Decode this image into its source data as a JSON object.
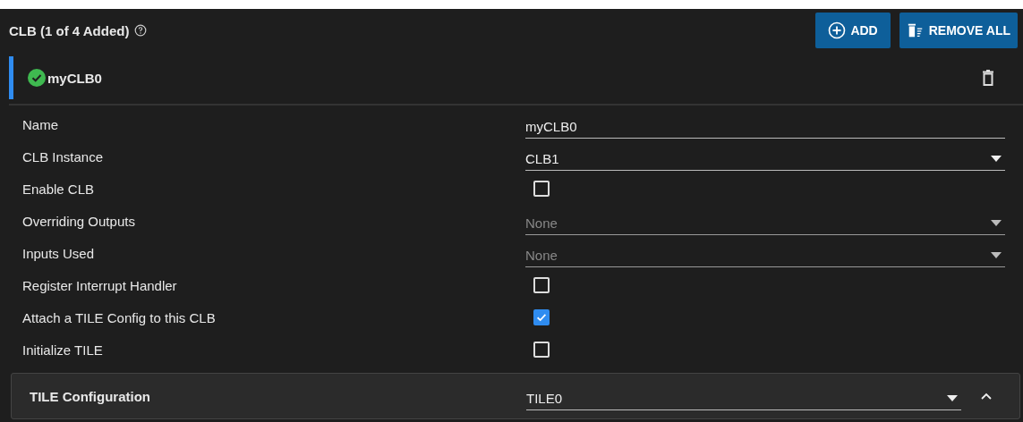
{
  "header": {
    "title": "CLB (1 of 4 Added)",
    "buttons": [
      {
        "kind": "add",
        "label": "ADD"
      },
      {
        "kind": "remove_all",
        "label": "REMOVE ALL"
      }
    ]
  },
  "instance": {
    "name": "myCLB0",
    "valid": true
  },
  "fields": [
    {
      "label": "Name",
      "kind": "text",
      "value": "myCLB0"
    },
    {
      "label": "CLB Instance",
      "kind": "select",
      "value": "CLB1",
      "disabled": false
    },
    {
      "label": "Enable CLB",
      "kind": "checkbox",
      "checked": false
    },
    {
      "label": "Overriding Outputs",
      "kind": "select",
      "value": "None",
      "disabled": true
    },
    {
      "label": "Inputs Used",
      "kind": "select",
      "value": "None",
      "disabled": true
    },
    {
      "label": "Register Interrupt Handler",
      "kind": "checkbox",
      "checked": false
    },
    {
      "label": "Attach a TILE Config to this CLB",
      "kind": "checkbox",
      "checked": true
    },
    {
      "label": "Initialize TILE",
      "kind": "checkbox",
      "checked": false
    }
  ],
  "section": {
    "title": "TILE Configuration",
    "value": "TILE0",
    "expanded": true
  }
}
